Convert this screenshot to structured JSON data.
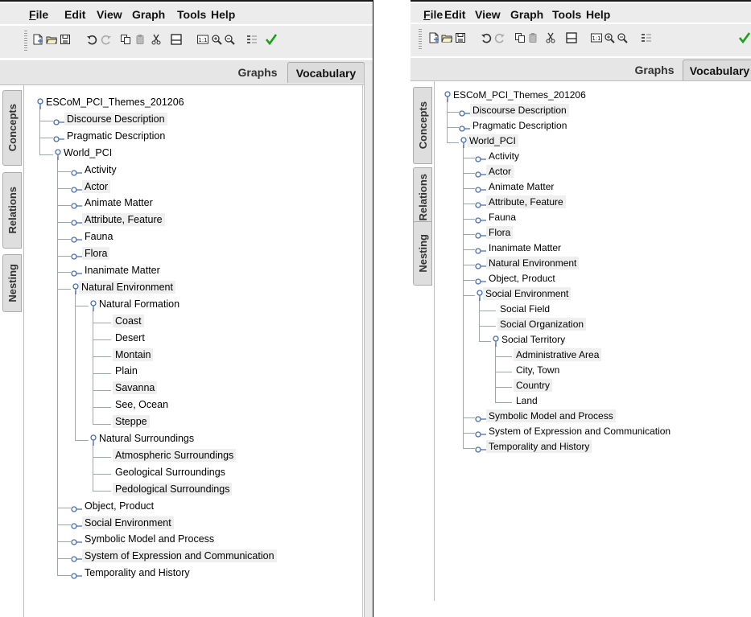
{
  "menu": [
    {
      "label": "File",
      "underline": true
    },
    {
      "label": "Edit"
    },
    {
      "label": "View"
    },
    {
      "label": "Graph"
    },
    {
      "label": "Tools"
    },
    {
      "label": "Help"
    }
  ],
  "toolbar": {
    "buttons": [
      "new-document-icon",
      "open-folder-icon",
      "save-icon",
      "undo-icon",
      "redo-icon",
      "copy-icon",
      "paste-icon",
      "cut-icon",
      "layout-icon",
      "zoom-100-icon",
      "zoom-in-icon",
      "zoom-out-icon",
      "properties-icon",
      "validate-check-icon"
    ],
    "zoom_label": "1:1"
  },
  "tabs": {
    "graphs": "Graphs",
    "vocabulary": "Vocabulary"
  },
  "side_tabs": [
    "Concepts",
    "Relations",
    "Nesting"
  ],
  "colors": {
    "check": "#1aa01a",
    "toolbar_bg": "#ececec",
    "tab_bg": "#dedede",
    "icon_blue": "#4a6fb0"
  },
  "left_panel": {
    "tree": [
      {
        "label": "ESCoM_PCI_Themes_201206",
        "depth": 0,
        "type": "open"
      },
      {
        "label": "Discourse Description",
        "depth": 1,
        "type": "closed",
        "hl": true
      },
      {
        "label": "Pragmatic Description",
        "depth": 1,
        "type": "closed"
      },
      {
        "label": "World_PCI",
        "depth": 1,
        "type": "open"
      },
      {
        "label": "Activity",
        "depth": 2,
        "type": "closed"
      },
      {
        "label": "Actor",
        "depth": 2,
        "type": "closed",
        "hl": true
      },
      {
        "label": "Animate Matter",
        "depth": 2,
        "type": "closed"
      },
      {
        "label": "Attribute, Feature",
        "depth": 2,
        "type": "closed",
        "hl": true
      },
      {
        "label": "Fauna",
        "depth": 2,
        "type": "closed"
      },
      {
        "label": "Flora",
        "depth": 2,
        "type": "closed",
        "hl": true
      },
      {
        "label": "Inanimate Matter",
        "depth": 2,
        "type": "closed"
      },
      {
        "label": "Natural Environment",
        "depth": 2,
        "type": "open",
        "hl": true
      },
      {
        "label": "Natural Formation",
        "depth": 3,
        "type": "open"
      },
      {
        "label": "Coast",
        "depth": 4,
        "type": "leaf",
        "hl": true
      },
      {
        "label": "Desert",
        "depth": 4,
        "type": "leaf"
      },
      {
        "label": "Montain",
        "depth": 4,
        "type": "leaf",
        "hl": true
      },
      {
        "label": "Plain",
        "depth": 4,
        "type": "leaf"
      },
      {
        "label": "Savanna",
        "depth": 4,
        "type": "leaf",
        "hl": true
      },
      {
        "label": "See, Ocean",
        "depth": 4,
        "type": "leaf"
      },
      {
        "label": "Steppe",
        "depth": 4,
        "type": "leaf",
        "hl": true
      },
      {
        "label": "Natural Surroundings",
        "depth": 3,
        "type": "open"
      },
      {
        "label": "Atmospheric Surroundings",
        "depth": 4,
        "type": "leaf",
        "hl": true
      },
      {
        "label": "Geological Surroundings",
        "depth": 4,
        "type": "leaf"
      },
      {
        "label": "Pedological Surroundings",
        "depth": 4,
        "type": "leaf",
        "hl": true
      },
      {
        "label": "Object, Product",
        "depth": 2,
        "type": "closed"
      },
      {
        "label": "Social Environment",
        "depth": 2,
        "type": "closed",
        "hl": true
      },
      {
        "label": "Symbolic Model and Process",
        "depth": 2,
        "type": "closed"
      },
      {
        "label": "System of Expression and Communication",
        "depth": 2,
        "type": "closed",
        "hl": true
      },
      {
        "label": "Temporality and History",
        "depth": 2,
        "type": "closed"
      }
    ]
  },
  "right_panel": {
    "tree": [
      {
        "label": "ESCoM_PCI_Themes_201206",
        "depth": 0,
        "type": "open"
      },
      {
        "label": "Discourse Description",
        "depth": 1,
        "type": "closed",
        "hl": true
      },
      {
        "label": "Pragmatic Description",
        "depth": 1,
        "type": "closed"
      },
      {
        "label": "World_PCI",
        "depth": 1,
        "type": "open",
        "hl": true
      },
      {
        "label": "Activity",
        "depth": 2,
        "type": "closed"
      },
      {
        "label": "Actor",
        "depth": 2,
        "type": "closed",
        "hl": true
      },
      {
        "label": "Animate Matter",
        "depth": 2,
        "type": "closed"
      },
      {
        "label": "Attribute, Feature",
        "depth": 2,
        "type": "closed",
        "hl": true
      },
      {
        "label": "Fauna",
        "depth": 2,
        "type": "closed"
      },
      {
        "label": "Flora",
        "depth": 2,
        "type": "closed",
        "hl": true
      },
      {
        "label": "Inanimate Matter",
        "depth": 2,
        "type": "closed"
      },
      {
        "label": "Natural Environment",
        "depth": 2,
        "type": "closed",
        "hl": true
      },
      {
        "label": "Object, Product",
        "depth": 2,
        "type": "closed"
      },
      {
        "label": "Social Environment",
        "depth": 2,
        "type": "open",
        "hl": true
      },
      {
        "label": "Social Field",
        "depth": 3,
        "type": "leaf"
      },
      {
        "label": "Social Organization",
        "depth": 3,
        "type": "leaf",
        "hl": true
      },
      {
        "label": "Social Territory",
        "depth": 3,
        "type": "open"
      },
      {
        "label": "Administrative Area",
        "depth": 4,
        "type": "leaf",
        "hl": true
      },
      {
        "label": "City, Town",
        "depth": 4,
        "type": "leaf"
      },
      {
        "label": "Country",
        "depth": 4,
        "type": "leaf",
        "hl": true
      },
      {
        "label": "Land",
        "depth": 4,
        "type": "leaf"
      },
      {
        "label": "Symbolic Model and Process",
        "depth": 2,
        "type": "closed",
        "hl": true
      },
      {
        "label": "System of Expression and Communication",
        "depth": 2,
        "type": "closed"
      },
      {
        "label": "Temporality and History",
        "depth": 2,
        "type": "closed",
        "hl": true
      }
    ]
  }
}
